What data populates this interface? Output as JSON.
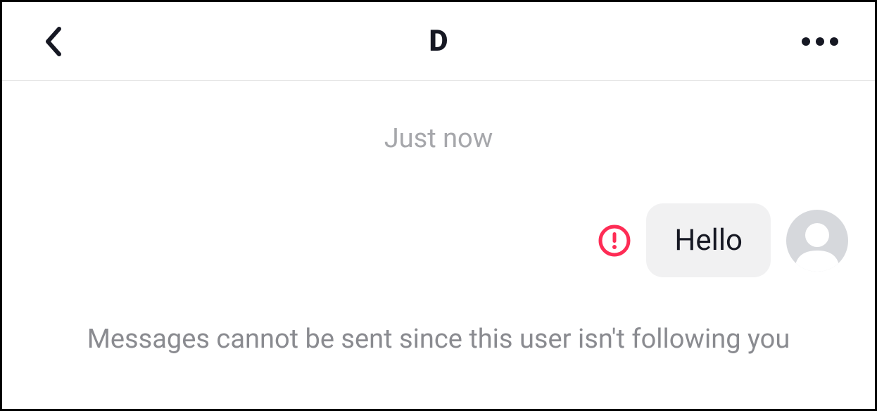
{
  "header": {
    "title": "D"
  },
  "chat": {
    "timestamp": "Just now",
    "messages": [
      {
        "text": "Hello",
        "error": true,
        "mine": true
      }
    ],
    "status_message": "Messages cannot be sent since this user isn't following you"
  }
}
